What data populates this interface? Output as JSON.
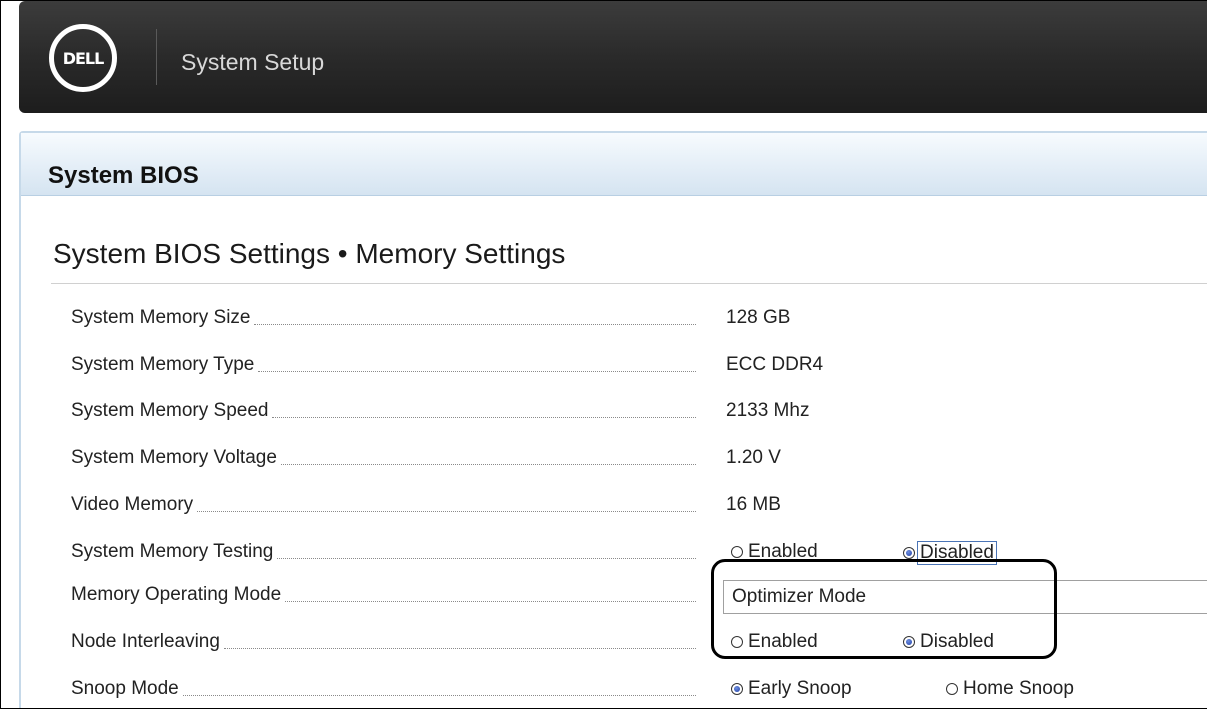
{
  "header": {
    "logo_text": "DELL",
    "title": "System Setup"
  },
  "panel": {
    "title": "System BIOS",
    "section_title": "System BIOS Settings • Memory Settings"
  },
  "settings": [
    {
      "label": "System Memory Size",
      "value": "128 GB"
    },
    {
      "label": "System Memory Type",
      "value": "ECC DDR4"
    },
    {
      "label": "System Memory Speed",
      "value": "2133 Mhz"
    },
    {
      "label": "System Memory Voltage",
      "value": "1.20 V"
    },
    {
      "label": "Video Memory",
      "value": "16 MB"
    },
    {
      "label": "System Memory Testing",
      "options": [
        "Enabled",
        "Disabled"
      ],
      "selected": "Disabled"
    },
    {
      "label": "Memory Operating Mode",
      "value": "Optimizer Mode"
    },
    {
      "label": "Node Interleaving",
      "options": [
        "Enabled",
        "Disabled"
      ],
      "selected": "Disabled"
    },
    {
      "label": "Snoop Mode",
      "options": [
        "Early Snoop",
        "Home Snoop"
      ],
      "selected": "Early Snoop"
    }
  ]
}
